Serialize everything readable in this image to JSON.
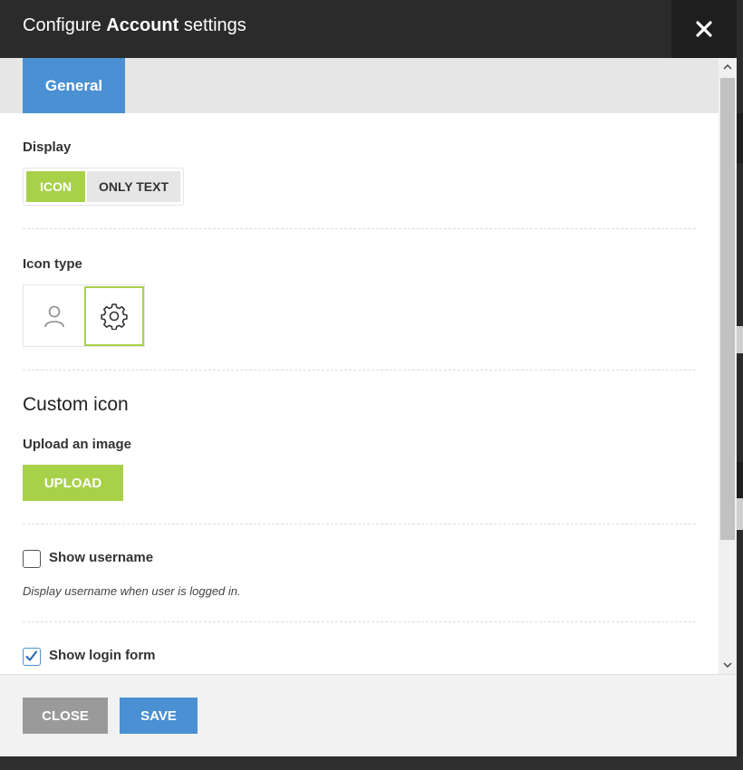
{
  "header": {
    "title_prefix": "Configure",
    "title_bold": "Account",
    "title_suffix": "settings",
    "close_icon": "close-icon"
  },
  "tabs": [
    {
      "label": "General",
      "active": true
    }
  ],
  "display": {
    "label": "Display",
    "options": [
      "ICON",
      "ONLY TEXT"
    ],
    "selected": "ICON"
  },
  "icon_type": {
    "label": "Icon type",
    "options": [
      "user-icon",
      "gear-icon"
    ],
    "selected": "gear-icon"
  },
  "custom_icon": {
    "heading": "Custom icon",
    "upload_label": "Upload an image",
    "upload_button": "UPLOAD"
  },
  "show_username": {
    "label": "Show username",
    "checked": false,
    "hint": "Display username when user is logged in."
  },
  "show_login_form": {
    "label": "Show login form",
    "checked": true
  },
  "footer": {
    "close_label": "CLOSE",
    "save_label": "SAVE"
  },
  "colors": {
    "accent_blue": "#4a90d2",
    "accent_green": "#a8d14a",
    "header_bg": "#2b2b2b"
  }
}
